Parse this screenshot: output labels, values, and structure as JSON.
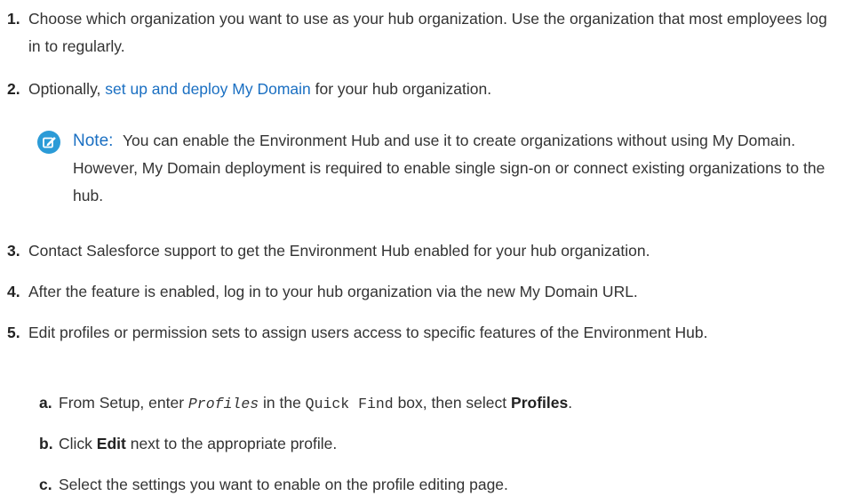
{
  "steps": [
    {
      "num": "1.",
      "text": "Choose which organization you want to use as your hub organization. Use the organization that most employees log in to regularly."
    },
    {
      "num": "2.",
      "text_before": "Optionally, ",
      "link": "set up and deploy My Domain",
      "text_after": " for your hub organization."
    },
    {
      "num": "3.",
      "text": "Contact Salesforce support to get the Environment Hub enabled for your hub organization."
    },
    {
      "num": "4.",
      "text": "After the feature is enabled, log in to your hub organization via the new My Domain URL."
    },
    {
      "num": "5.",
      "text": "Edit profiles or permission sets to assign users access to specific features of the Environment Hub."
    }
  ],
  "note": {
    "label": "Note:",
    "text": "You can enable the Environment Hub and use it to create organizations without using My Domain. However, My Domain deployment is required to enable single sign-on or connect existing organizations to the hub.",
    "icon": "edit-note-icon"
  },
  "substeps": [
    {
      "num": "a.",
      "t1": "From Setup, enter ",
      "code1": "Profiles",
      "t2": " in the ",
      "code2": "Quick Find",
      "t3": " box, then select ",
      "bold": "Profiles",
      "t4": "."
    },
    {
      "num": "b.",
      "t1": "Click ",
      "bold": "Edit",
      "t2": " next to the appropriate profile."
    },
    {
      "num": "c.",
      "text": "Select the settings you want to enable on the profile editing page."
    }
  ],
  "colors": {
    "link": "#1a6fc2",
    "icon": "#2b9bd7",
    "text": "#333333"
  }
}
